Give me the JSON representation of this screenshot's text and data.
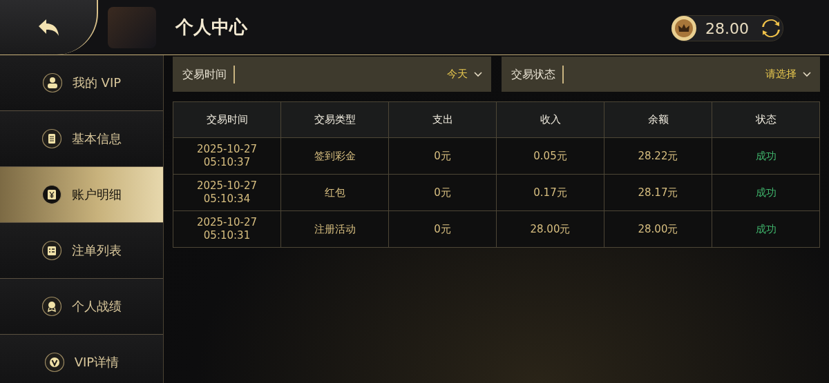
{
  "header": {
    "title": "个人中心",
    "balance": "28.00"
  },
  "sidebar": {
    "items": [
      {
        "label": "我的 VIP",
        "selected": false
      },
      {
        "label": "基本信息",
        "selected": false
      },
      {
        "label": "账户明细",
        "selected": true
      },
      {
        "label": "注单列表",
        "selected": false
      },
      {
        "label": "个人战绩",
        "selected": false
      },
      {
        "label": "VIP详情",
        "selected": false
      }
    ]
  },
  "filters": [
    {
      "label": "交易时间",
      "value": "今天"
    },
    {
      "label": "交易状态",
      "value": "请选择"
    }
  ],
  "table": {
    "columns": [
      "交易时间",
      "交易类型",
      "支出",
      "收入",
      "余额",
      "状态"
    ],
    "rows": [
      {
        "time": "2025-10-27\n05:10:37",
        "type": "签到彩金",
        "out": "0元",
        "in": "0.05元",
        "balance": "28.22元",
        "status": "成功",
        "kind": "success"
      },
      {
        "time": "2025-10-27\n05:10:34",
        "type": "红包",
        "out": "0元",
        "in": "0.17元",
        "balance": "28.17元",
        "status": "成功",
        "kind": "success"
      },
      {
        "time": "2025-10-27\n05:10:31",
        "type": "注册活动",
        "out": "0元",
        "in": "28.00元",
        "balance": "28.00元",
        "status": "成功",
        "kind": "success"
      }
    ]
  }
}
